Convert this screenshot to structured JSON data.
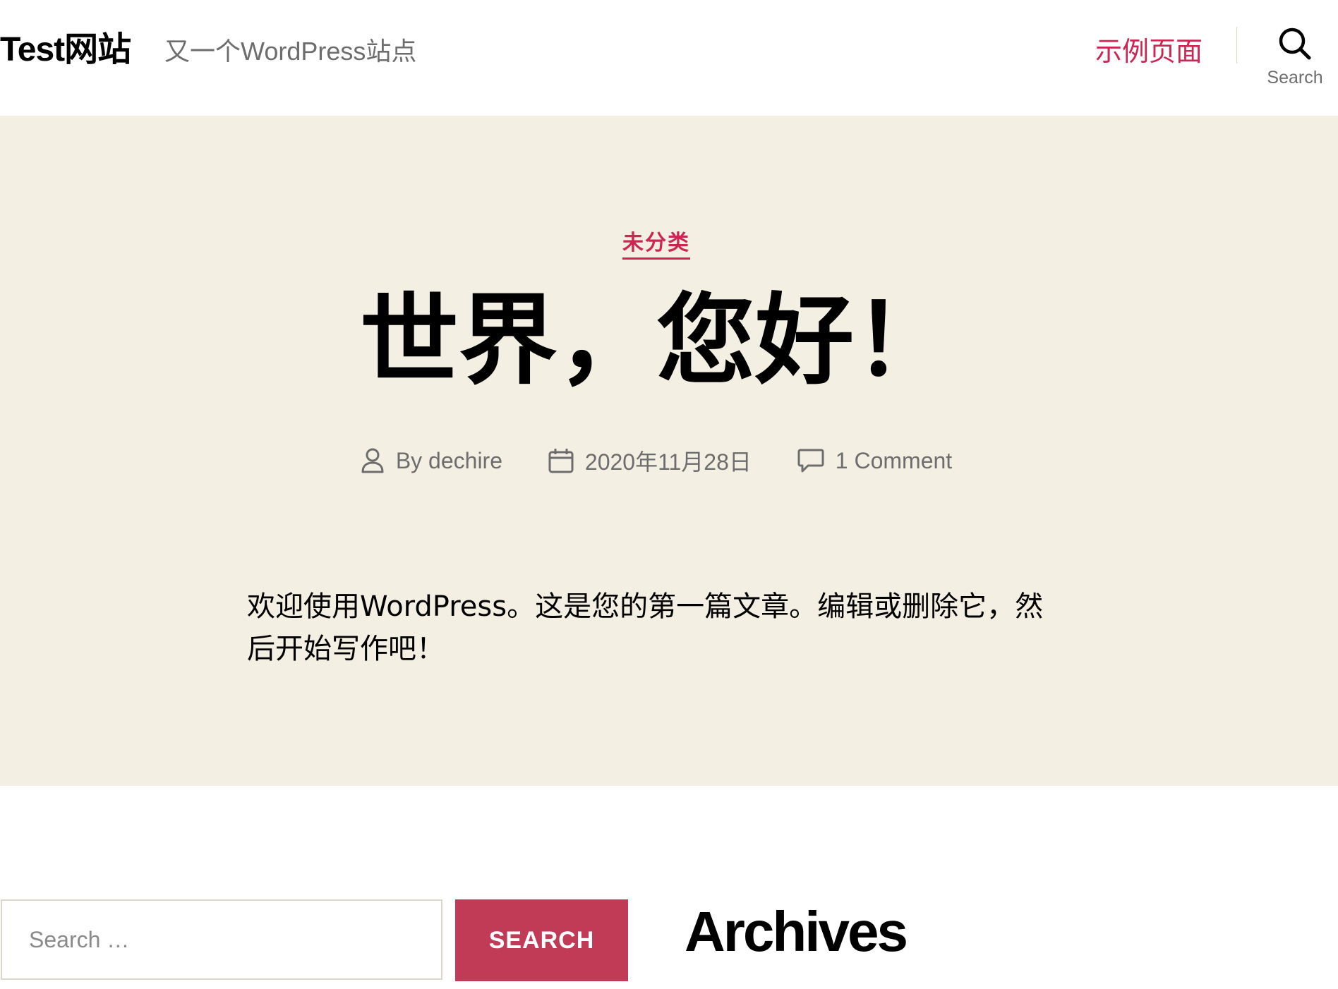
{
  "header": {
    "site_title": "Test网站",
    "site_description": "又一个WordPress站点",
    "nav_items": [
      {
        "label": "示例页面"
      }
    ],
    "search_toggle_label": "Search"
  },
  "post": {
    "category": "未分类",
    "title": "世界，您好！",
    "meta": {
      "author": "By dechire",
      "date": "2020年11月28日",
      "comments": "1 Comment"
    },
    "content": "欢迎使用WordPress。这是您的第一篇文章。编辑或删除它，然后开始写作吧！"
  },
  "widgets": {
    "search": {
      "placeholder": "Search …",
      "button_label": "Search"
    },
    "archives_title": "Archives"
  },
  "colors": {
    "accent": "#cd2653",
    "hero_background": "#f4efe3",
    "search_button": "#c13b57",
    "secondary_text": "#6d6d6d"
  },
  "icons": {
    "search": "search-icon",
    "author": "user-icon",
    "date": "calendar-icon",
    "comments": "comment-icon"
  }
}
